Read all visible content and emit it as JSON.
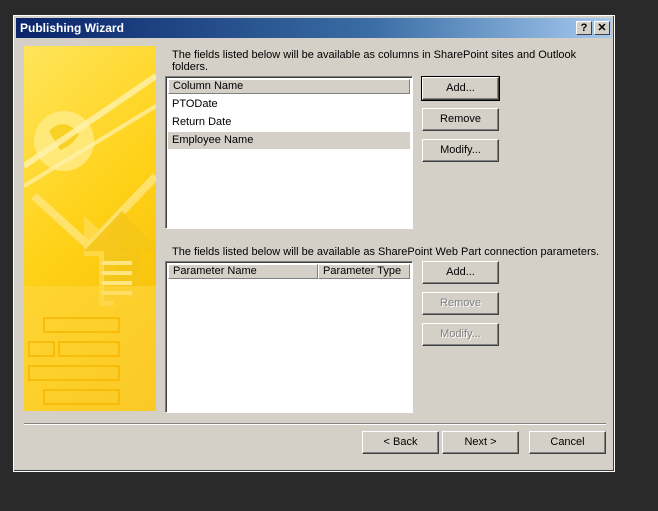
{
  "window": {
    "title": "Publishing Wizard",
    "help_glyph": "?",
    "close_glyph": "✕"
  },
  "columns_section": {
    "description": "The fields listed below will be available as columns in SharePoint sites and Outlook folders.",
    "header": "Column Name",
    "items": [
      "PTODate",
      "Return Date",
      "Employee Name"
    ],
    "selected_index": 2,
    "buttons": {
      "add": "Add...",
      "remove": "Remove",
      "modify": "Modify..."
    }
  },
  "params_section": {
    "description": "The fields listed below will be available as SharePoint Web Part connection parameters.",
    "headers": [
      "Parameter Name",
      "Parameter Type"
    ],
    "buttons": {
      "add": "Add...",
      "remove": "Remove",
      "modify": "Modify..."
    }
  },
  "footer": {
    "back": "< Back",
    "next": "Next >",
    "cancel": "Cancel"
  }
}
